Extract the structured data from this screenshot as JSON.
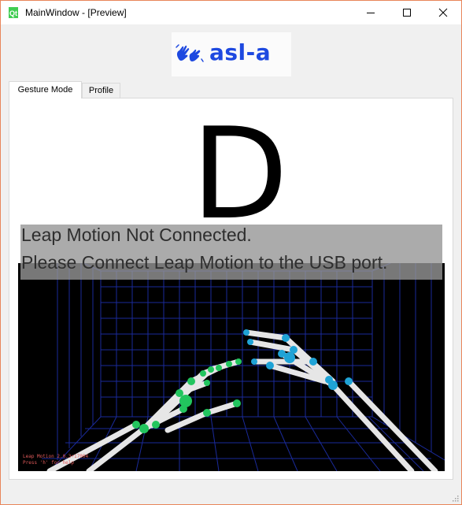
{
  "window": {
    "title": "MainWindow - [Preview]"
  },
  "logo": {
    "text": "asl-a",
    "icon": "signing-hands-icon",
    "color": "#1e49e0"
  },
  "tabs": [
    {
      "label": "Gesture Mode",
      "active": true
    },
    {
      "label": "Profile",
      "active": false
    }
  ],
  "gesture": {
    "letter": "D"
  },
  "status": {
    "line1": "Leap Motion Not Connected.",
    "line2": "Please Connect Leap Motion to the USB port."
  },
  "visualizer": {
    "hud_line1": "Leap Motion 2.0.3+17004",
    "hud_line2": "Press 'h' for help",
    "joint_color_left": "#22c55e",
    "joint_color_right": "#1fa3d6",
    "grid_color": "#1a2a9a"
  }
}
